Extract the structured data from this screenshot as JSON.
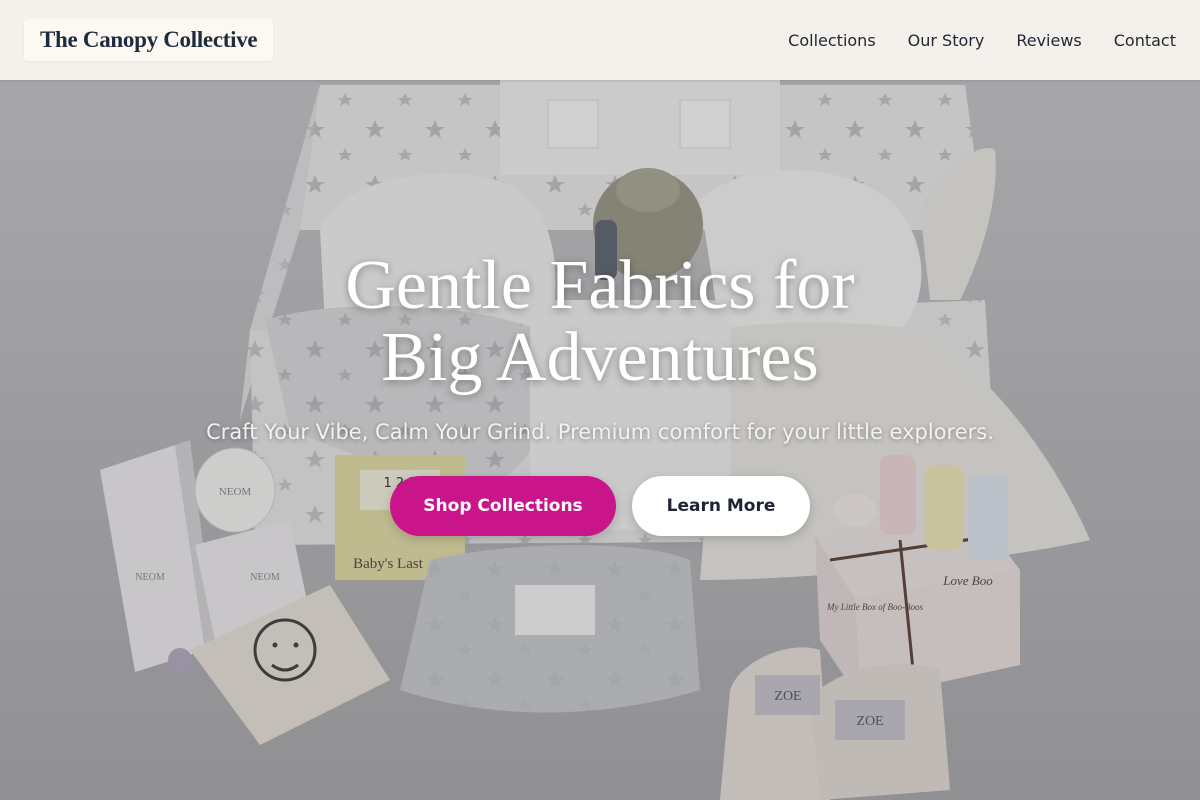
{
  "header": {
    "logo_text": "The Canopy Collective",
    "nav": [
      {
        "label": "Collections"
      },
      {
        "label": "Our Story"
      },
      {
        "label": "Reviews"
      },
      {
        "label": "Contact"
      }
    ]
  },
  "hero": {
    "title_line1": "Gentle Fabrics for",
    "title_line2": "Big Adventures",
    "subtitle": "Craft Your Vibe, Calm Your Grind. Premium comfort for your little explorers.",
    "primary_button": "Shop Collections",
    "secondary_button": "Learn More",
    "photo_text": {
      "candle_brand": "NEOM",
      "book_title": "Baby's Last",
      "book_numbers": "1 2 3",
      "gift_box_brand": "Love Boo",
      "gift_box_label": "My Little Box of Boo-Boos",
      "muslin_brand": "ZOE"
    }
  },
  "colors": {
    "accent": "#c9148a",
    "header_bg": "#faf6f2",
    "logo_text": "#1e2a3d",
    "button_secondary_bg": "#ffffff"
  }
}
